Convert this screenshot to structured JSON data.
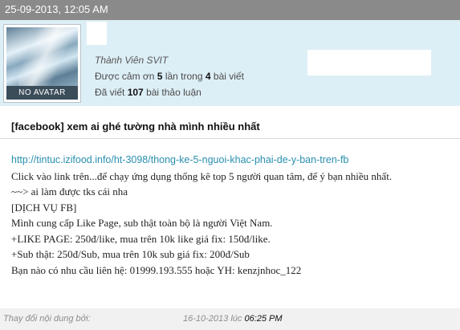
{
  "post": {
    "timestamp": "25-09-2013, 12:05 AM",
    "title": "[facebook] xem ai ghé tường nhà mình nhiều nhất",
    "body": {
      "link": "http://tintuc.izifood.info/ht-3098/thong-ke-5-nguoi-khac-phai-de-y-ban-tren-fb",
      "lines": [
        "Click vào link trên...để chạy ứng dụng thống kê top 5 người quan tâm, để ý bạn nhiều nhất.",
        "~~> ai làm được tks cái nha",
        "[DỊCH VỤ FB]",
        "Mình cung cấp Like Page, sub thật toàn bộ là người Việt Nam.",
        "+LIKE PAGE: 250đ/like, mua trên 10k like giá fix: 150đ/like.",
        "+Sub thật: 250đ/Sub, mua trên 10k sub giá fix: 200đ/Sub",
        "Bạn nào có nhu cầu liên hệ: 01999.193.555 hoặc YH: kenzjnhoc_122"
      ]
    }
  },
  "user": {
    "avatar_text": "NO AVATAR",
    "rank": "Thành Viên SVIT",
    "thanks_prefix": "Được cảm ơn",
    "thanks_count": "5",
    "thanks_mid": "lần trong",
    "thanks_posts": "4",
    "thanks_suffix": "bài viết",
    "posts_prefix": "Đã viết",
    "posts_count": "107",
    "posts_suffix": "bài thảo luận"
  },
  "footer": {
    "edited_label": "Thay đổi nội dung bởi:",
    "edited_date": "16-10-2013 lúc",
    "edited_time": "06:25 PM"
  }
}
